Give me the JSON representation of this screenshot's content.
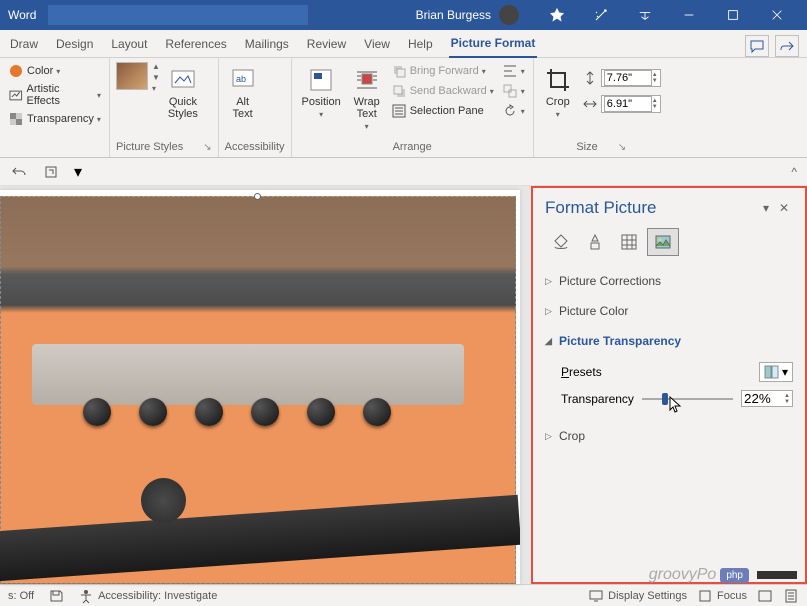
{
  "titlebar": {
    "app": "Word",
    "user": "Brian Burgess"
  },
  "tabs": {
    "items": [
      "Draw",
      "Design",
      "Layout",
      "References",
      "Mailings",
      "Review",
      "View",
      "Help",
      "Picture Format"
    ],
    "active": "Picture Format"
  },
  "ribbon": {
    "adjust": {
      "color": "Color",
      "effects": "Artistic Effects",
      "transparency": "Transparency"
    },
    "styles": {
      "quick": "Quick\nStyles",
      "label": "Picture Styles"
    },
    "accessibility": {
      "alt": "Alt\nText",
      "label": "Accessibility"
    },
    "arrange": {
      "position": "Position",
      "wrap": "Wrap\nText",
      "forward": "Bring Forward",
      "backward": "Send Backward",
      "selection": "Selection Pane",
      "label": "Arrange"
    },
    "size": {
      "crop": "Crop",
      "h": "7.76\"",
      "w": "6.91\"",
      "label": "Size"
    }
  },
  "pane": {
    "title": "Format Picture",
    "sections": {
      "corrections": "Picture Corrections",
      "color": "Picture Color",
      "transparency": "Picture Transparency",
      "crop": "Crop"
    },
    "transparency": {
      "presets": "Presets",
      "label": "Transparency",
      "value": "22%",
      "slider_pct": 22
    }
  },
  "status": {
    "autosave": "s: Off",
    "accessibility": "Accessibility: Investigate",
    "display": "Display Settings",
    "focus": "Focus"
  },
  "watermark": {
    "text": "groovyPo",
    "badge": "php"
  }
}
